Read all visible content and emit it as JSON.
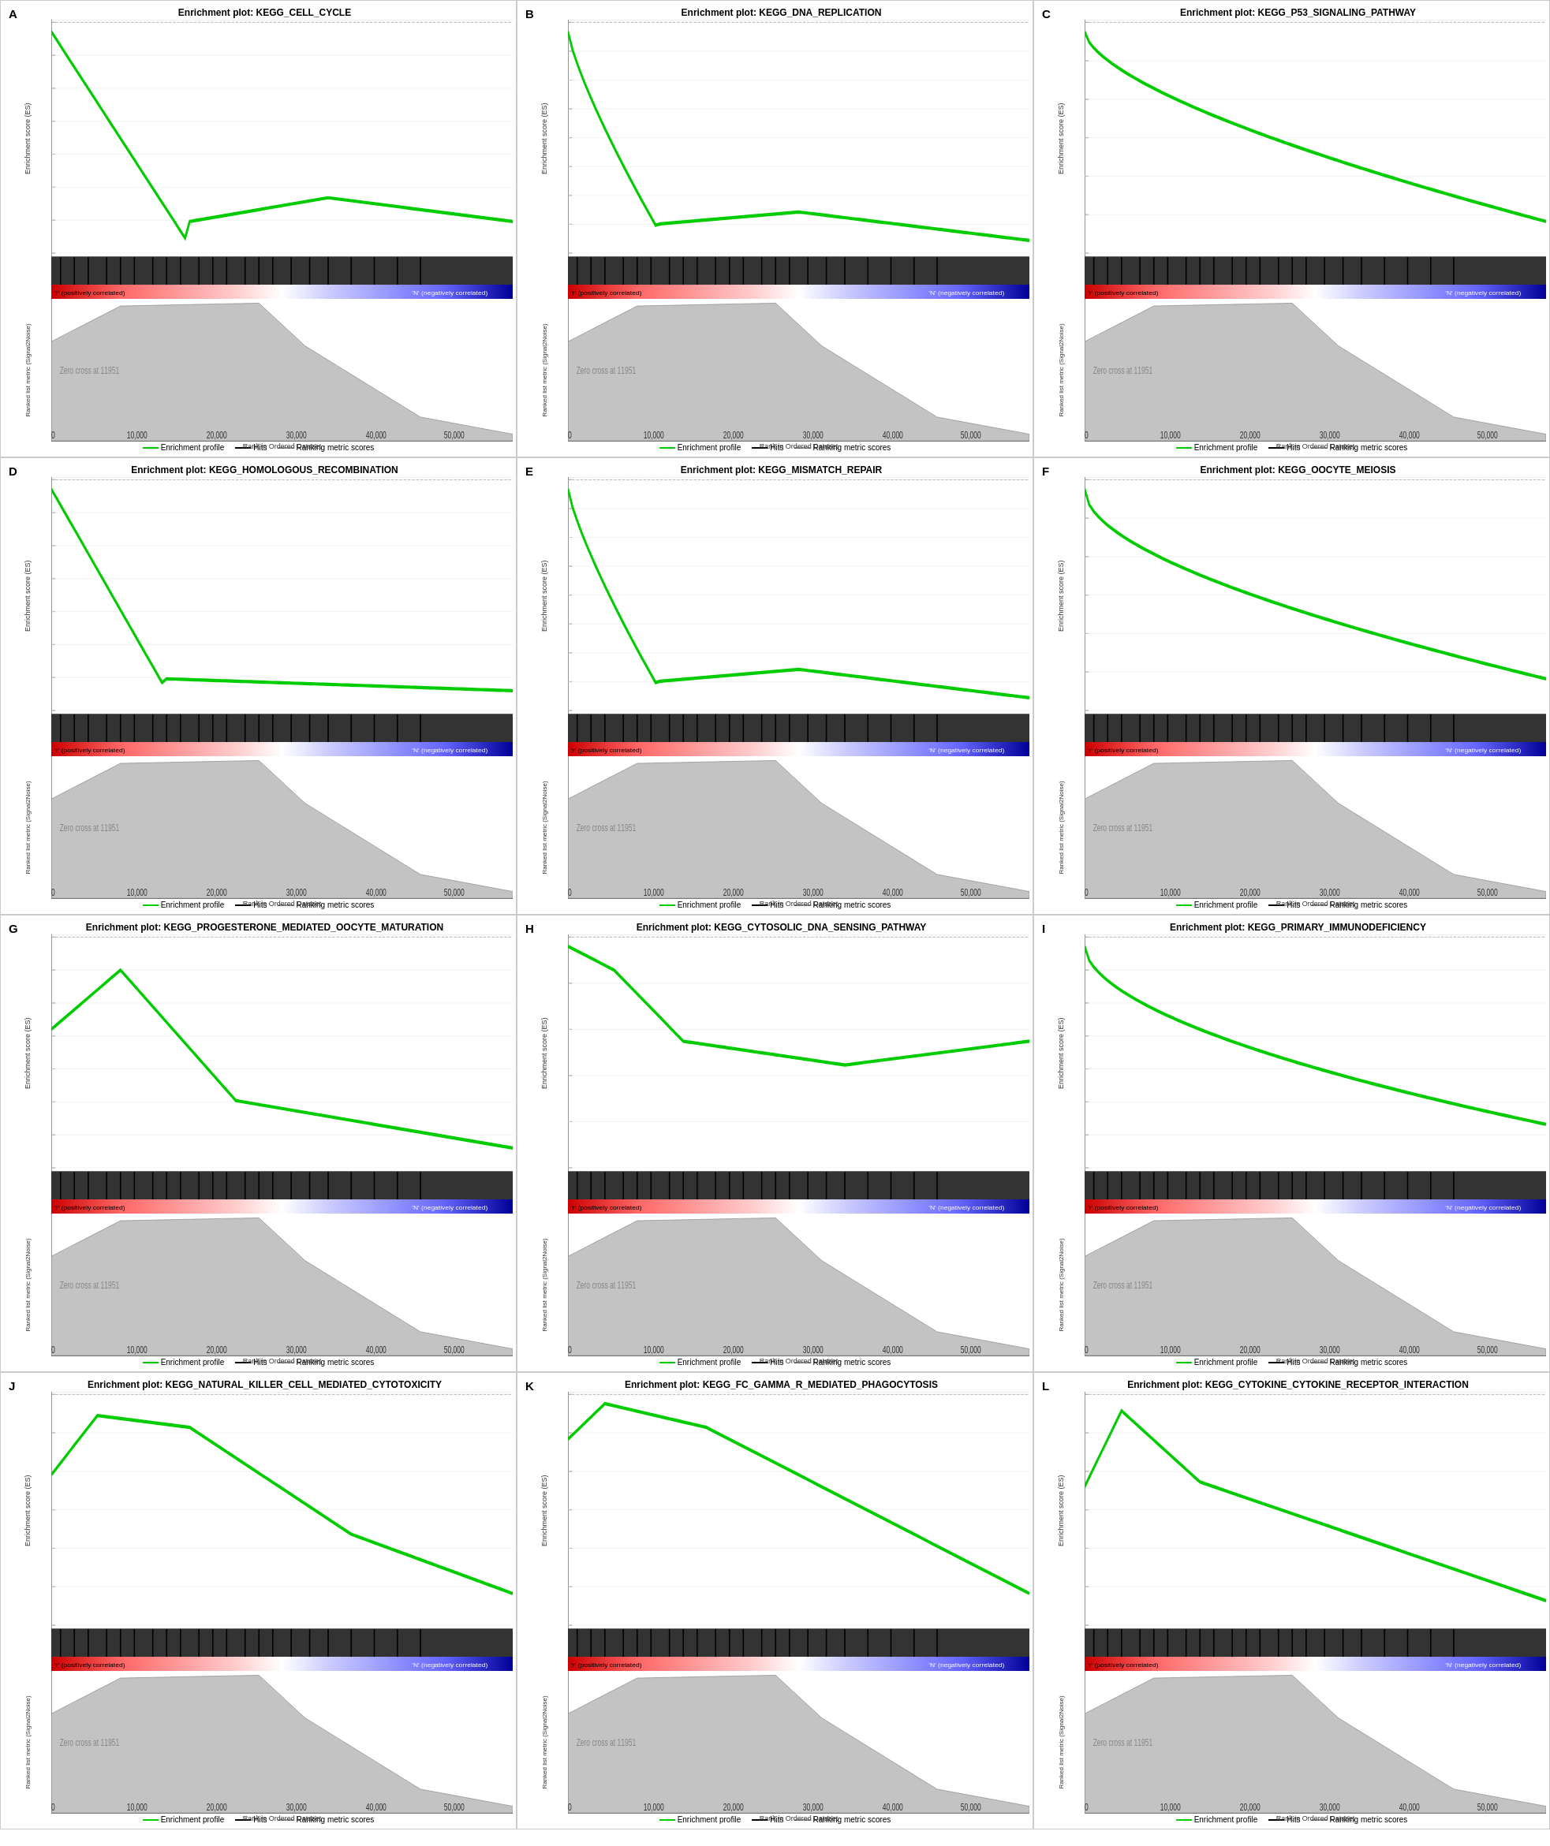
{
  "panels": [
    {
      "letter": "A",
      "title": "Enrichment plot: KEGG_CELL_CYCLE",
      "curve_type": "steep_down",
      "zero_cross": "Zero cross at 11951",
      "es_range": "0.0 to -0.7"
    },
    {
      "letter": "B",
      "title": "Enrichment plot: KEGG_DNA_REPLICATION",
      "curve_type": "steep_down2",
      "zero_cross": "Zero cross at 11951",
      "es_range": "0.0 to -0.8"
    },
    {
      "letter": "C",
      "title": "Enrichment plot: KEGG_P53_SIGNALING_PATHWAY",
      "curve_type": "gradual_down",
      "zero_cross": "Zero cross at 11951",
      "es_range": "0.0 to -0.6"
    },
    {
      "letter": "D",
      "title": "Enrichment plot: KEGG_HOMOLOGOUS_RECOMBINATION",
      "curve_type": "steep_down",
      "zero_cross": "Zero cross at 11951",
      "es_range": "0.0 to -0.8"
    },
    {
      "letter": "E",
      "title": "Enrichment plot: KEGG_MISMATCH_REPAIR",
      "curve_type": "steep_down2",
      "zero_cross": "Zero cross at 11951",
      "es_range": "0.1 to -0.7"
    },
    {
      "letter": "F",
      "title": "Enrichment plot: KEGG_OOCYTE_MEIOSIS",
      "curve_type": "gradual_down2",
      "zero_cross": "Zero cross at 11951",
      "es_range": "0.0 to -0.6"
    },
    {
      "letter": "G",
      "title": "Enrichment plot: KEGG_PROGESTERONE_MEDIATED_OOCYTE_MATURATION",
      "curve_type": "up_then_down",
      "zero_cross": "Zero cross at 11951",
      "es_range": "0.2 to -0.5"
    },
    {
      "letter": "H",
      "title": "Enrichment plot: KEGG_CYTOSOLIC_DNA_SENSING_PATHWAY",
      "curve_type": "dip_down",
      "zero_cross": "Zero cross at 11951",
      "es_range": "0.0 to -0.5"
    },
    {
      "letter": "I",
      "title": "Enrichment plot: KEGG_PRIMARY_IMMUNODEFICIENCY",
      "curve_type": "gradual_down3",
      "zero_cross": "Zero cross at 11951",
      "es_range": "0.0 to -0.7"
    },
    {
      "letter": "J",
      "title": "Enrichment plot: KEGG_NATURAL_KILLER_CELL_MEDIATED_CYTOTOXICITY",
      "curve_type": "up_hold_down",
      "zero_cross": "Zero cross at 11951",
      "es_range": "0.1 to -0.5"
    },
    {
      "letter": "K",
      "title": "Enrichment plot: KEGG_FC_GAMMA_R_MEDIATED_PHAGOCYTOSIS",
      "curve_type": "hold_then_down",
      "zero_cross": "Zero cross at 11951",
      "es_range": "0.2 to -0.4"
    },
    {
      "letter": "L",
      "title": "Enrichment plot: KEGG_CYTOKINE_CYTOKINE_RECEPTOR_INTERACTION",
      "curve_type": "up_then_down2",
      "zero_cross": "Zero cross at 11951",
      "es_range": "0.1 to -0.5"
    }
  ],
  "legend": {
    "enrichment_profile": "Enrichment profile",
    "hits": "Hits",
    "ranking_metric_scores": "Ranking metric scores"
  },
  "x_axis_label": "Rank in Ordered Dataset",
  "y_axis_enrichment": "Enrichment score (ES)",
  "y_axis_ranked": "Ranked list metric (Signal2Noise)",
  "positively_correlated": "'r' (positively correlated)",
  "negatively_correlated": "'N' (negatively correlated)",
  "x_ticks": [
    "0",
    "10,000",
    "20,000",
    "30,000",
    "40,000",
    "50,000"
  ]
}
